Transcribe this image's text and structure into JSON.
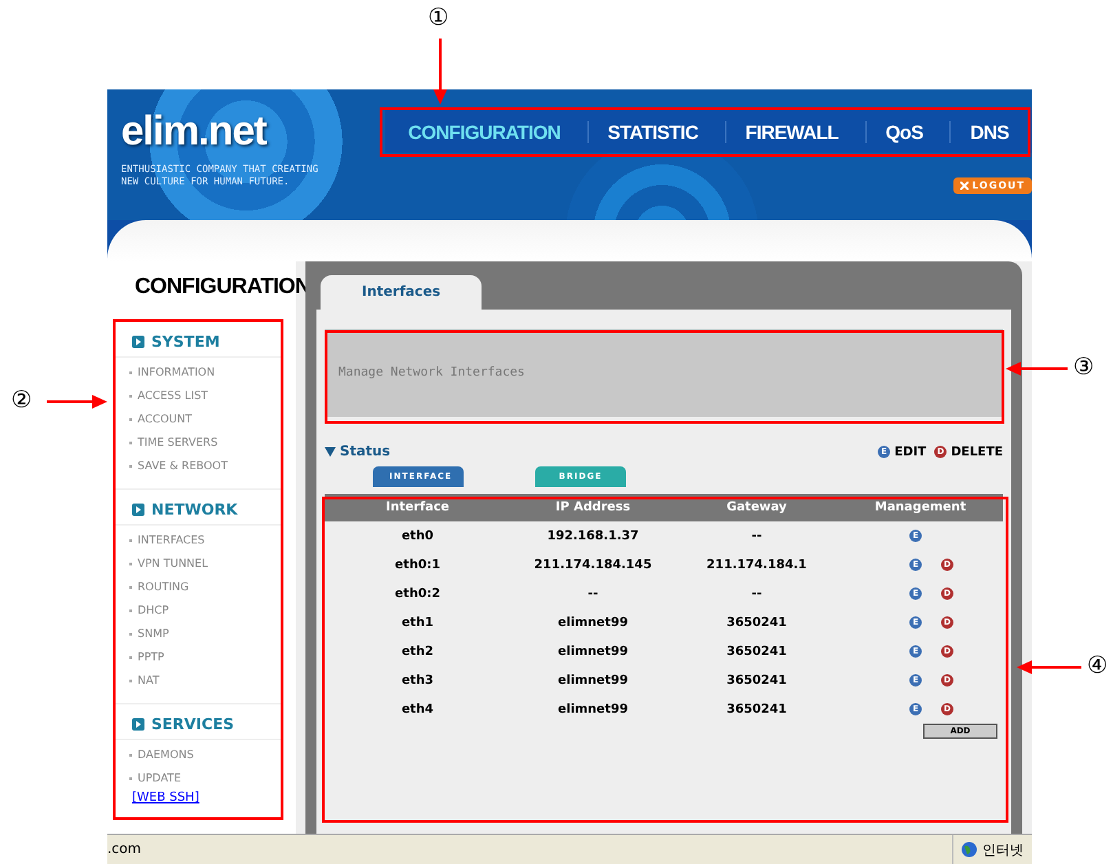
{
  "header": {
    "logo": "elim.net",
    "tagline": [
      "ENTHUSIASTIC COMPANY THAT CREATING",
      "NEW CULTURE FOR HUMAN FUTURE."
    ],
    "nav": [
      {
        "label": "CONFIGURATION",
        "selected": true
      },
      {
        "label": "STATISTIC",
        "selected": false
      },
      {
        "label": "FIREWALL",
        "selected": false
      },
      {
        "label": "QoS",
        "selected": false
      },
      {
        "label": "DNS",
        "selected": false
      }
    ],
    "logout": "LOGOUT"
  },
  "sidebar": {
    "title": "CONFIGURATION",
    "sections": [
      {
        "title": "SYSTEM",
        "items": [
          "INFORMATION",
          "ACCESS LIST",
          "ACCOUNT",
          "TIME SERVERS",
          "SAVE & REBOOT"
        ]
      },
      {
        "title": "NETWORK",
        "items": [
          "INTERFACES",
          "VPN TUNNEL",
          "ROUTING",
          "DHCP",
          "SNMP",
          "PPTP",
          "NAT"
        ]
      },
      {
        "title": "SERVICES",
        "items": [
          "DAEMONS",
          "UPDATE"
        ]
      }
    ],
    "link": "[WEB SSH]"
  },
  "tabs": [
    {
      "label": "Interfaces",
      "selected": true
    }
  ],
  "description": "Manage Network Interfaces",
  "status": {
    "title": "Status",
    "legend": [
      {
        "icon": "E",
        "label": "EDIT",
        "kind": "edit"
      },
      {
        "icon": "D",
        "label": "DELETE",
        "kind": "delete"
      }
    ],
    "subtabs": [
      {
        "label": "INTERFACE",
        "color": "#2f6fb0"
      },
      {
        "label": "BRIDGE",
        "color": "#2aaca6"
      }
    ]
  },
  "table": {
    "columns": [
      "Interface",
      "IP Address",
      "Gateway",
      "Management"
    ],
    "rows": [
      {
        "cells": [
          "eth0",
          "192.168.1.37",
          "--"
        ],
        "actions": [
          {
            "kind": "edit",
            "icon": "E"
          }
        ]
      },
      {
        "cells": [
          "eth0:1",
          "211.174.184.145",
          "211.174.184.1"
        ],
        "actions": [
          {
            "kind": "edit",
            "icon": "E"
          },
          {
            "kind": "delete",
            "icon": "D"
          }
        ]
      },
      {
        "cells": [
          "eth0:2",
          "--",
          "--"
        ],
        "actions": [
          {
            "kind": "edit",
            "icon": "E"
          },
          {
            "kind": "delete",
            "icon": "D"
          }
        ]
      },
      {
        "cells": [
          "eth1",
          "elimnet99",
          "3650241"
        ],
        "actions": [
          {
            "kind": "edit",
            "icon": "E"
          },
          {
            "kind": "delete",
            "icon": "D"
          }
        ]
      },
      {
        "cells": [
          "eth2",
          "elimnet99",
          "3650241"
        ],
        "actions": [
          {
            "kind": "edit",
            "icon": "E"
          },
          {
            "kind": "delete",
            "icon": "D"
          }
        ]
      },
      {
        "cells": [
          "eth3",
          "elimnet99",
          "3650241"
        ],
        "actions": [
          {
            "kind": "edit",
            "icon": "E"
          },
          {
            "kind": "delete",
            "icon": "D"
          }
        ]
      },
      {
        "cells": [
          "eth4",
          "elimnet99",
          "3650241"
        ],
        "actions": [
          {
            "kind": "edit",
            "icon": "E"
          },
          {
            "kind": "delete",
            "icon": "D"
          }
        ]
      }
    ],
    "add_button": "ADD"
  },
  "status_bar": {
    "left": ".com",
    "zone": "인터넷"
  },
  "callouts": [
    "①",
    "②",
    "③",
    "④"
  ]
}
